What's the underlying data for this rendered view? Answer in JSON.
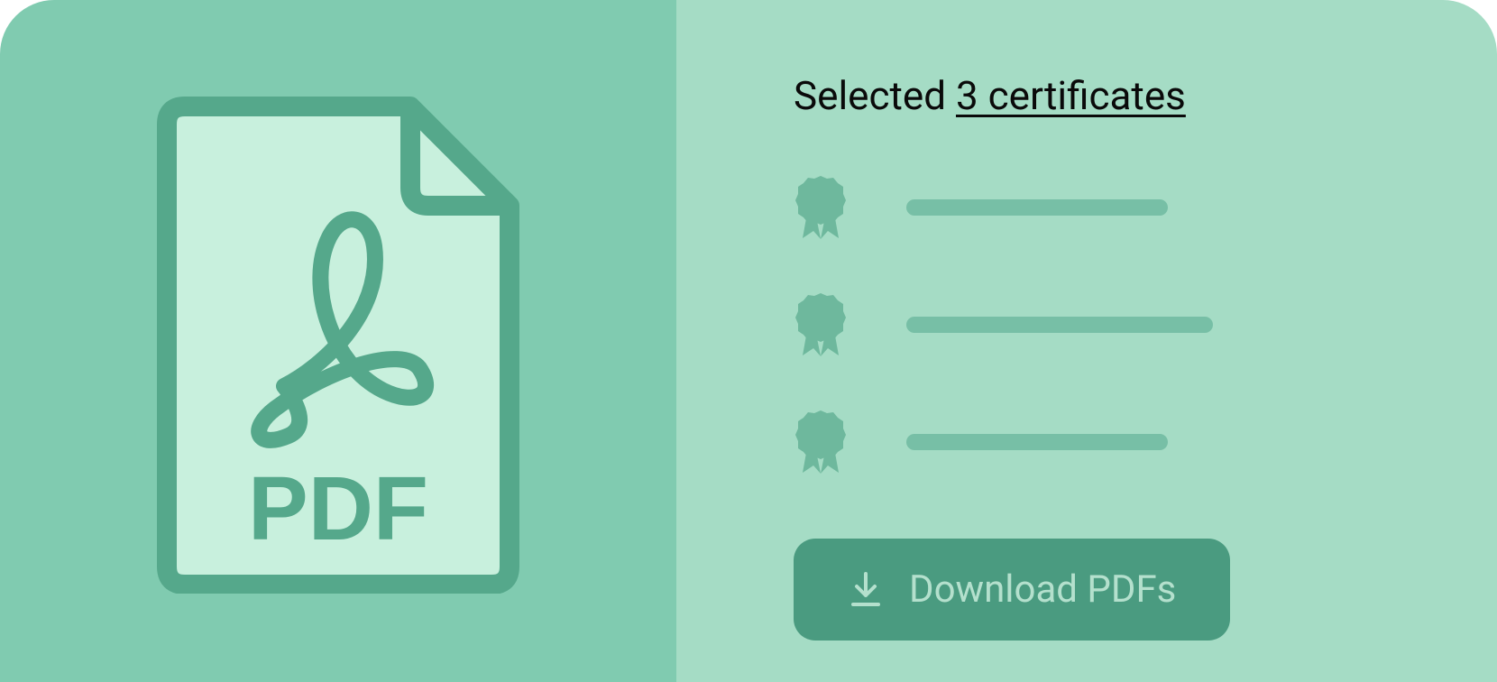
{
  "left": {
    "file_label": "PDF"
  },
  "right": {
    "heading_prefix": "Selected ",
    "heading_count": "3 certificates",
    "certificates": [
      {
        "id": 1
      },
      {
        "id": 2
      },
      {
        "id": 3
      }
    ],
    "download_button_label": "Download PDFs"
  },
  "colors": {
    "left_bg": "#80cbb0",
    "right_bg": "#a5dcc5",
    "accent": "#4a9b80",
    "light_accent": "#77bfa6",
    "file_fill": "#c8f0dd",
    "button_text": "#b4e0cd"
  }
}
